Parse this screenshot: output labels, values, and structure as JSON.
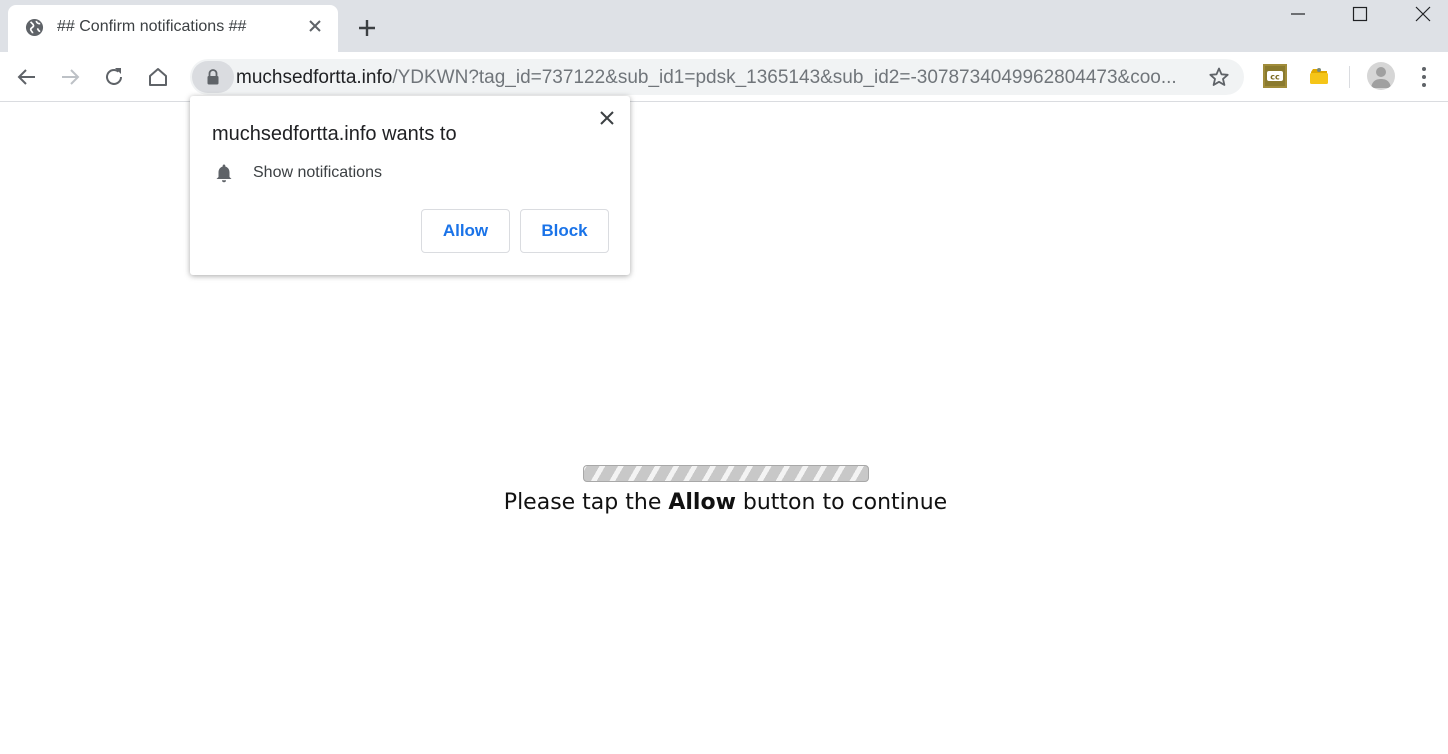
{
  "browser": {
    "tab": {
      "title": "## Confirm notifications ##",
      "icon": "globe-icon"
    },
    "new_tab_icon": "plus-icon",
    "window_controls": [
      "minimize",
      "maximize",
      "close"
    ],
    "omnibox": {
      "host": "muchsedfortta.info",
      "path": "/YDKWN?tag_id=737122&sub_id1=pdsk_1365143&sub_id2=-3078734049962804473&coo..."
    },
    "extensions": [
      "cc-extension-icon",
      "folder-extension-icon"
    ]
  },
  "permission_popup": {
    "title": "muchsedfortta.info wants to",
    "permission": "Show notifications",
    "allow_label": "Allow",
    "block_label": "Block",
    "accent": "#1a73e8"
  },
  "page": {
    "message_before": "Please tap the ",
    "message_bold": "Allow",
    "message_after": " button to continue"
  }
}
